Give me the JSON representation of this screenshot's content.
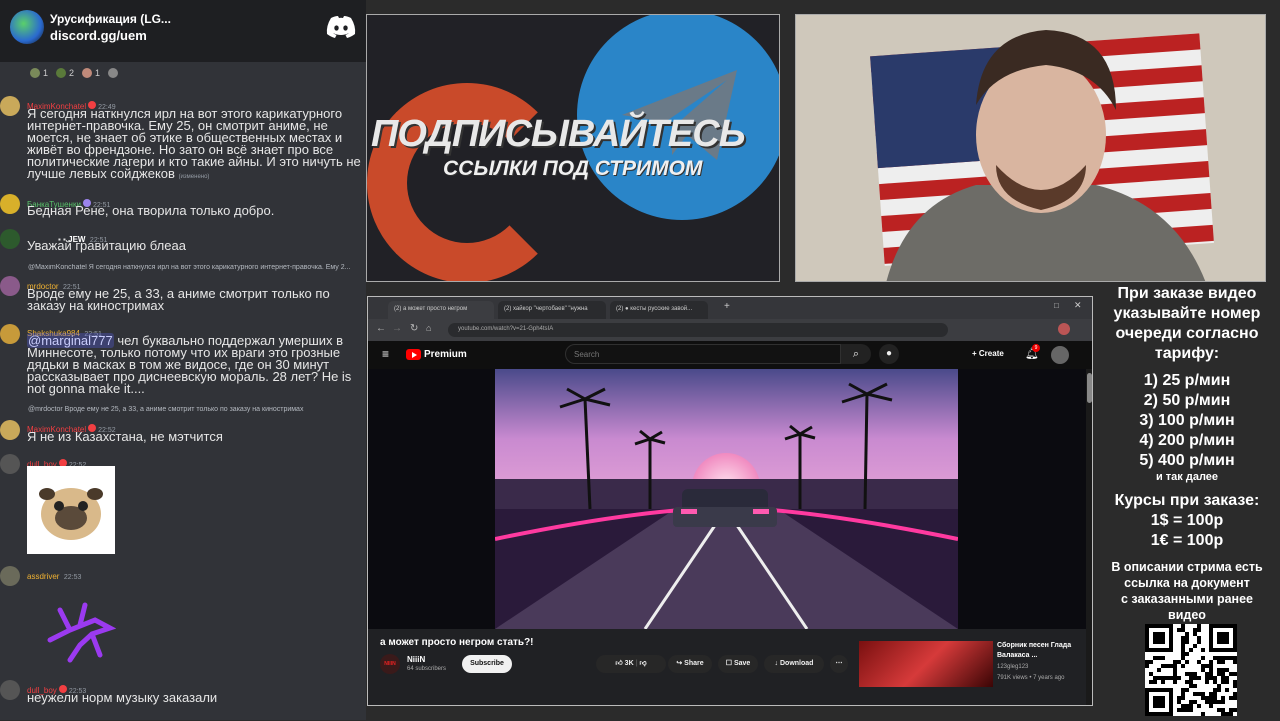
{
  "discord": {
    "server_name": "Урусификация (LG...",
    "invite_link": "discord.gg/uem",
    "reactions": [
      {
        "count": "1"
      },
      {
        "count": "2"
      },
      {
        "count": "1"
      }
    ]
  },
  "chat": {
    "messages": [
      {
        "user": "MaximKonchatel",
        "time": "22:49",
        "text": "Я сегодня наткнулся ирл на вот этого карикатурного интернет-правочка. Ему 25, он смотрит аниме, не моется, не знает об этике в общественных местах и живёт во френдзоне. Но зато он всё знает про все политические лагери и кто такие айны. И это ничуть не лучше левых сойджеков",
        "edited": "(изменено)"
      },
      {
        "user": "БанкаТушенки",
        "time": "22:51",
        "text": "Бедная Рене, она творила только добро."
      },
      {
        "user": "JEW",
        "time": "22:51",
        "text": "Уважай гравитацию блеаа"
      },
      {
        "reply": "@MaximKonchatel Я сегодня наткнулся ирл на вот этого карикатурного интернет-правочка. Ему 2...",
        "user": "mrdoctor",
        "time": "22:51",
        "text": "Вроде ему не 25, а 33, а аниме смотрит только по заказу на киностримах"
      },
      {
        "user": "Shakshuka984",
        "time": "22:51",
        "mention": "@marginal777",
        "text": " чел буквально поддержал умерших в Миннесоте, только потому что их враги это грозные дядьки в масках в том же видосе, где он 30 минут рассказывает про диснеевскую мораль. 28 лет? He is not gonna make it...."
      },
      {
        "reply": "@mrdoctor Вроде ему не 25, а 33, а аниме смотрит только по заказу на киностримах",
        "user": "MaximKonchatel",
        "time": "22:52",
        "text": "Я не из Казахстана, не мэтчится"
      },
      {
        "user": "dull_boy",
        "time": "22:52",
        "text": ""
      },
      {
        "user": "assdriver",
        "time": "22:53",
        "text": ""
      },
      {
        "user": "dull_boy",
        "time": "22:53",
        "text": "неужели норм музыку заказали"
      }
    ]
  },
  "banner": {
    "line1": "ПОДПИСЫВАЙТЕСЬ",
    "line2": "ССЫЛКИ ПОД СТРИМОМ",
    "patreon_color": "#c94a2a",
    "telegram_color": "#2a85c8"
  },
  "browser": {
    "tabs": [
      "(2) а может просто негром",
      "(2) хайкор \"чертобаев\" \"нужна",
      "(2) ● кесты русские завой..."
    ],
    "url": "youtube.com/watch?v=21-Gph4tsIA",
    "youtube": {
      "logo_text": "Premium",
      "search_placeholder": "Search",
      "create_label": "Create",
      "notification_count": "9",
      "video_title": "а может просто негром стать?!",
      "channel_name": "NiiiN",
      "channel_avatar_text": "NIIIN",
      "channel_subs": "64 subscribers",
      "subscribe_label": "Subscribe",
      "likes": "3K",
      "share_label": "Share",
      "save_label": "Save",
      "download_label": "Download",
      "recommended": {
        "title": "Сборник песен Глада Валакаса ...",
        "channel": "123gleg123",
        "meta": "791K views • 7 years ago"
      }
    }
  },
  "info_panel": {
    "heading": [
      "При заказе видео",
      "указывайте номер",
      "очереди согласно",
      "тарифу:"
    ],
    "tariffs": [
      "1) 25 р/мин",
      "2) 50 р/мин",
      "3) 100 р/мин",
      "4) 200 р/мин",
      "5) 400 р/мин"
    ],
    "tariffs_more": "и так далее",
    "rates_heading": "Курсы при заказе:",
    "rates": [
      "1$ = 100р",
      "1€ = 100р"
    ],
    "note": [
      "В описании стрима есть",
      "ссылка на документ",
      "с заказанными ранее",
      "видео"
    ]
  }
}
